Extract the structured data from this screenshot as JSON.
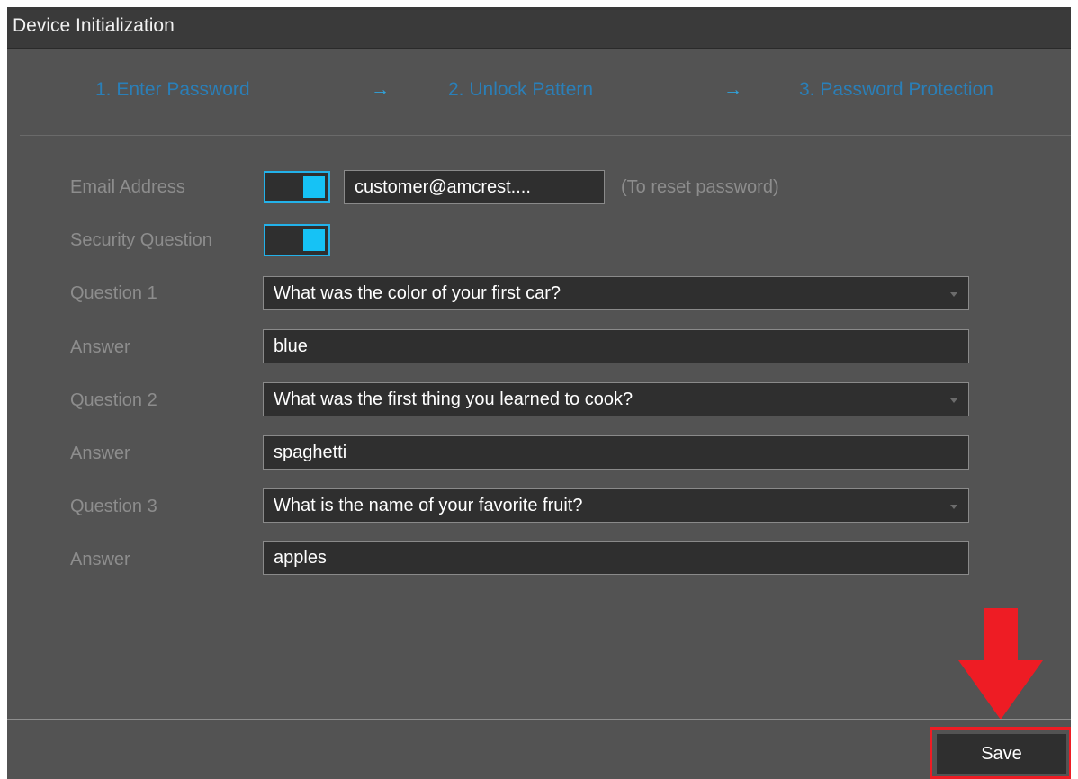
{
  "window": {
    "title": "Device Initialization"
  },
  "steps": [
    {
      "label": "1.  Enter Password"
    },
    {
      "label": "2.  Unlock Pattern"
    },
    {
      "label": "3.  Password Protection"
    }
  ],
  "step_arrow": "→",
  "form": {
    "email": {
      "label": "Email Address",
      "enabled": true,
      "value": "customer@amcrest....",
      "hint": "(To reset password)"
    },
    "security_question": {
      "label": "Security Question",
      "enabled": true
    },
    "question1": {
      "label": "Question 1",
      "value": "What was the color of your first car?"
    },
    "answer1": {
      "label": "Answer",
      "value": "blue"
    },
    "question2": {
      "label": "Question 2",
      "value": "What was the first thing you learned to cook?"
    },
    "answer2": {
      "label": "Answer",
      "value": "spaghetti"
    },
    "question3": {
      "label": "Question 3",
      "value": "What is the name of your favorite fruit?"
    },
    "answer3": {
      "label": "Answer",
      "value": "apples"
    }
  },
  "footer": {
    "save_label": "Save"
  },
  "colors": {
    "accent": "#16c2f5",
    "step_text": "#2a7fb8",
    "highlight": "#ee1c24"
  }
}
